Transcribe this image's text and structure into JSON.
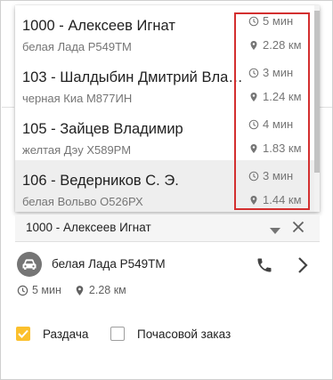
{
  "dropdown": {
    "items": [
      {
        "name": "1000 - Алексеев Игнат",
        "car": "белая Лада Р549ТМ",
        "time": "5 мин",
        "distance": "2.28 км"
      },
      {
        "name": "103 - Шалдыбин Дмитрий Вла…",
        "car": "черная Киа М877ИН",
        "time": "3 мин",
        "distance": "1.24 км"
      },
      {
        "name": "105 - Зайцев Владимир",
        "car": "желтая Дэу Х589РМ",
        "time": "4 мин",
        "distance": "1.83 км"
      },
      {
        "name": "106 - Ведерников С. Э.",
        "car": "белая Вольво О526РХ",
        "time": "3 мин",
        "distance": "1.44 км"
      }
    ],
    "selected_index": 3
  },
  "driver_select": {
    "value": "1000 - Алексеев Игнат"
  },
  "vehicle": {
    "label": "белая Лада Р549ТМ",
    "time": "5 мин",
    "distance": "2.28 км"
  },
  "options": {
    "delivery": {
      "label": "Раздача",
      "checked": true
    },
    "hourly": {
      "label": "Почасовой заказ",
      "checked": false
    }
  },
  "colors": {
    "accent": "#fbc02d",
    "highlight": "#d32f2f",
    "icon": "#757575"
  },
  "icons": [
    "clock-icon",
    "location-pin-icon",
    "dropdown-arrow-icon",
    "clear-icon",
    "car-icon",
    "phone-icon",
    "chevron-right-icon",
    "check-icon"
  ]
}
